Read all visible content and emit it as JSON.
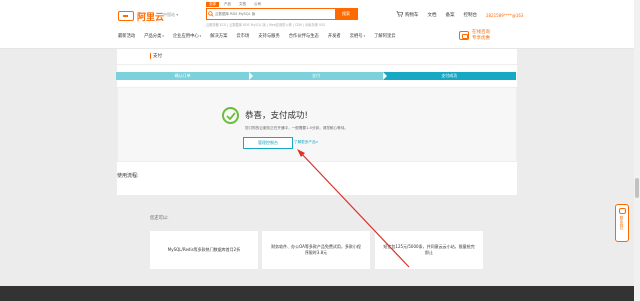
{
  "header": {
    "brand": "阿里云",
    "region": "中国站 ▾",
    "search_tabs": [
      "全部",
      "产品",
      "文档",
      "公司"
    ],
    "search_placeholder": "云数据库 RDS MySQL 版",
    "search_button": "搜索",
    "hotwords": "云服务器 ECS  |  云数据库 RDS MySQL 版  |  Web应用防火墙  |  CDN  |  对象存储 OSS",
    "cart_label": "购物车",
    "links": [
      "文档",
      "备案",
      "控制台"
    ],
    "user": "2821589****@163"
  },
  "nav": {
    "items": [
      "最新活动",
      "产品分类",
      "企业应用中心",
      "解决方案",
      "云市场",
      "支持与服务",
      "合作伙伴与生态",
      "开发者",
      "云栖号",
      "了解阿里云"
    ],
    "promo_line1": "在线咨询",
    "promo_line2": "专享优惠"
  },
  "page": {
    "title": "支付",
    "steps": [
      "确认订单",
      "支付",
      "支付成功"
    ],
    "success_title": "恭喜，支付成功!",
    "success_note": "您订购的云服务正在开通中，一般需要1-5分钟，请您耐心等待。",
    "console_button": "管理控制台",
    "more_link": "了解更多产品>",
    "faq_label": "使用流程:"
  },
  "recommend": {
    "title": "您还可以:",
    "cards": [
      "MySQL/Redis等多款热门数据库首月2折",
      "财务软件、办公OA等多款产品免费试用，多款小程序限时3.8元",
      "短信包125元/5000条，并同意云云小站，限量抢完即止"
    ]
  },
  "side_tab": {
    "label": "联系我们"
  },
  "colors": {
    "brand": "#ff6a00",
    "step_active": "#17a8c3",
    "step_inactive": "#7dd1dc",
    "success": "#6bbe3d",
    "annotation_arrow": "#d9312b"
  }
}
